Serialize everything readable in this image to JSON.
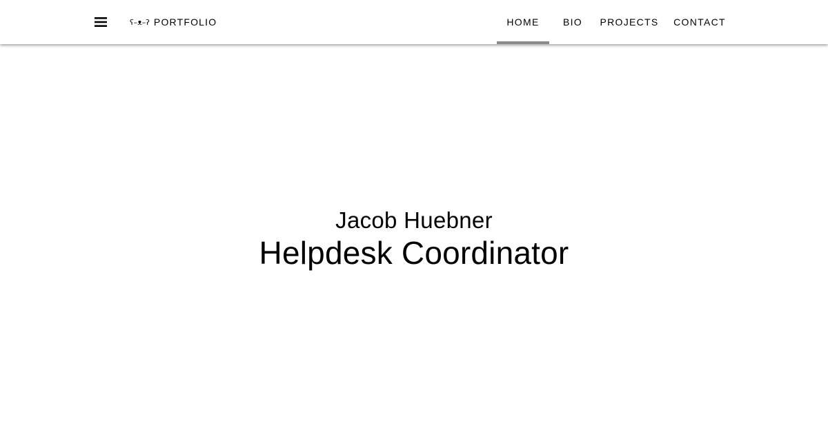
{
  "header": {
    "brand_emoticon": "ʕ–ᴥ–ʔ",
    "brand_label": "PORTFOLIO",
    "tabs": [
      {
        "label": "HOME",
        "active": true
      },
      {
        "label": "BIO",
        "active": false
      },
      {
        "label": "PROJECTS",
        "active": false
      },
      {
        "label": "CONTACT",
        "active": false
      }
    ],
    "menu_icon": "hamburger-menu-icon",
    "active_indicator_color": "#8a8a8a"
  },
  "hero": {
    "name": "Jacob Huebner",
    "title": "Helpdesk Coordinator"
  }
}
